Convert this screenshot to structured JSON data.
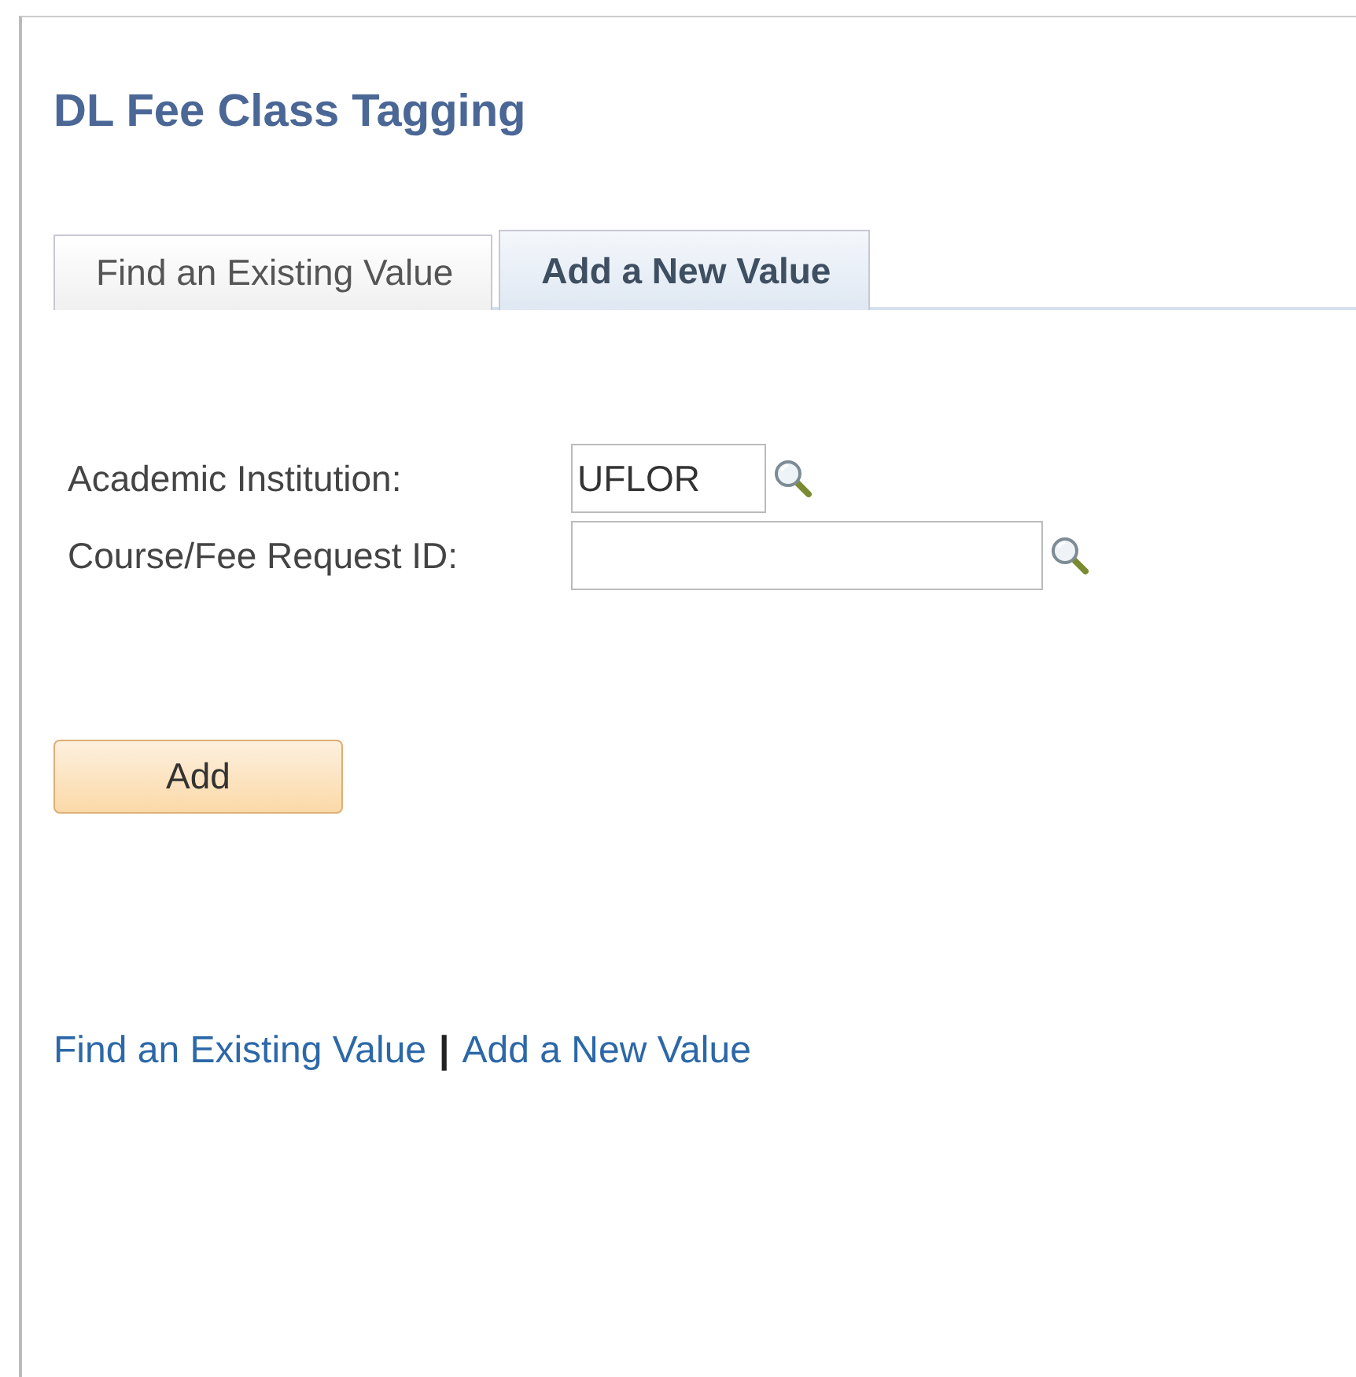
{
  "page_title": "DL Fee Class Tagging",
  "tabs": [
    {
      "label": "Find an Existing Value",
      "selected": false
    },
    {
      "label": "Add a New Value",
      "selected": true
    }
  ],
  "fields": [
    {
      "label": "Academic Institution:",
      "value": "UFLOR",
      "kind": "short"
    },
    {
      "label": "Course/Fee Request ID:",
      "kind": "long"
    }
  ],
  "add_button": "Add",
  "footer_links": [
    {
      "label": "Find an Existing Value"
    },
    {
      "label": "Add a New Value"
    }
  ],
  "footer_separator": "|"
}
